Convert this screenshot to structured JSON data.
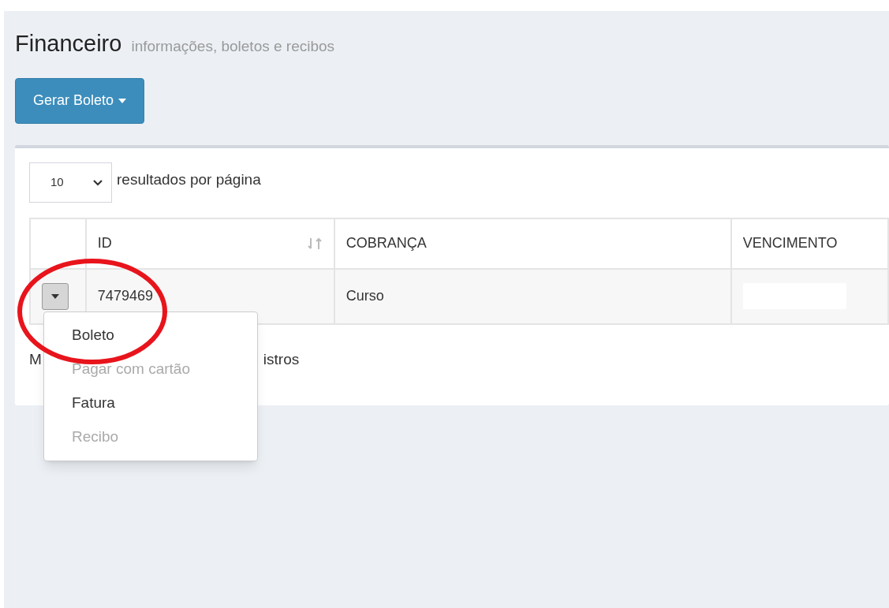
{
  "header": {
    "title": "Financeiro",
    "subtitle": "informações, boletos e recibos"
  },
  "generate_button": {
    "label": "Gerar Boleto"
  },
  "page_size": {
    "value": "10",
    "label": "resultados por página"
  },
  "table": {
    "columns": [
      {
        "sortable": false
      },
      {
        "label": "ID",
        "sortable": true
      },
      {
        "label": "COBRANÇA",
        "sortable": false
      },
      {
        "label": "VENCIMENTO",
        "sortable": false
      }
    ],
    "rows": [
      {
        "cells": [
          {
            "kind": "menu"
          },
          {
            "kind": "text",
            "text": "7479469"
          },
          {
            "kind": "text",
            "text": "Curso"
          },
          {
            "kind": "redacted"
          }
        ]
      }
    ]
  },
  "footer": {
    "before": "M",
    "after": "istros"
  },
  "row_menu": {
    "items": [
      {
        "label": "Boleto",
        "disabled": false
      },
      {
        "label": "Pagar com cartão",
        "disabled": true
      },
      {
        "label": "Fatura",
        "disabled": false
      },
      {
        "label": "Recibo",
        "disabled": true
      }
    ]
  }
}
